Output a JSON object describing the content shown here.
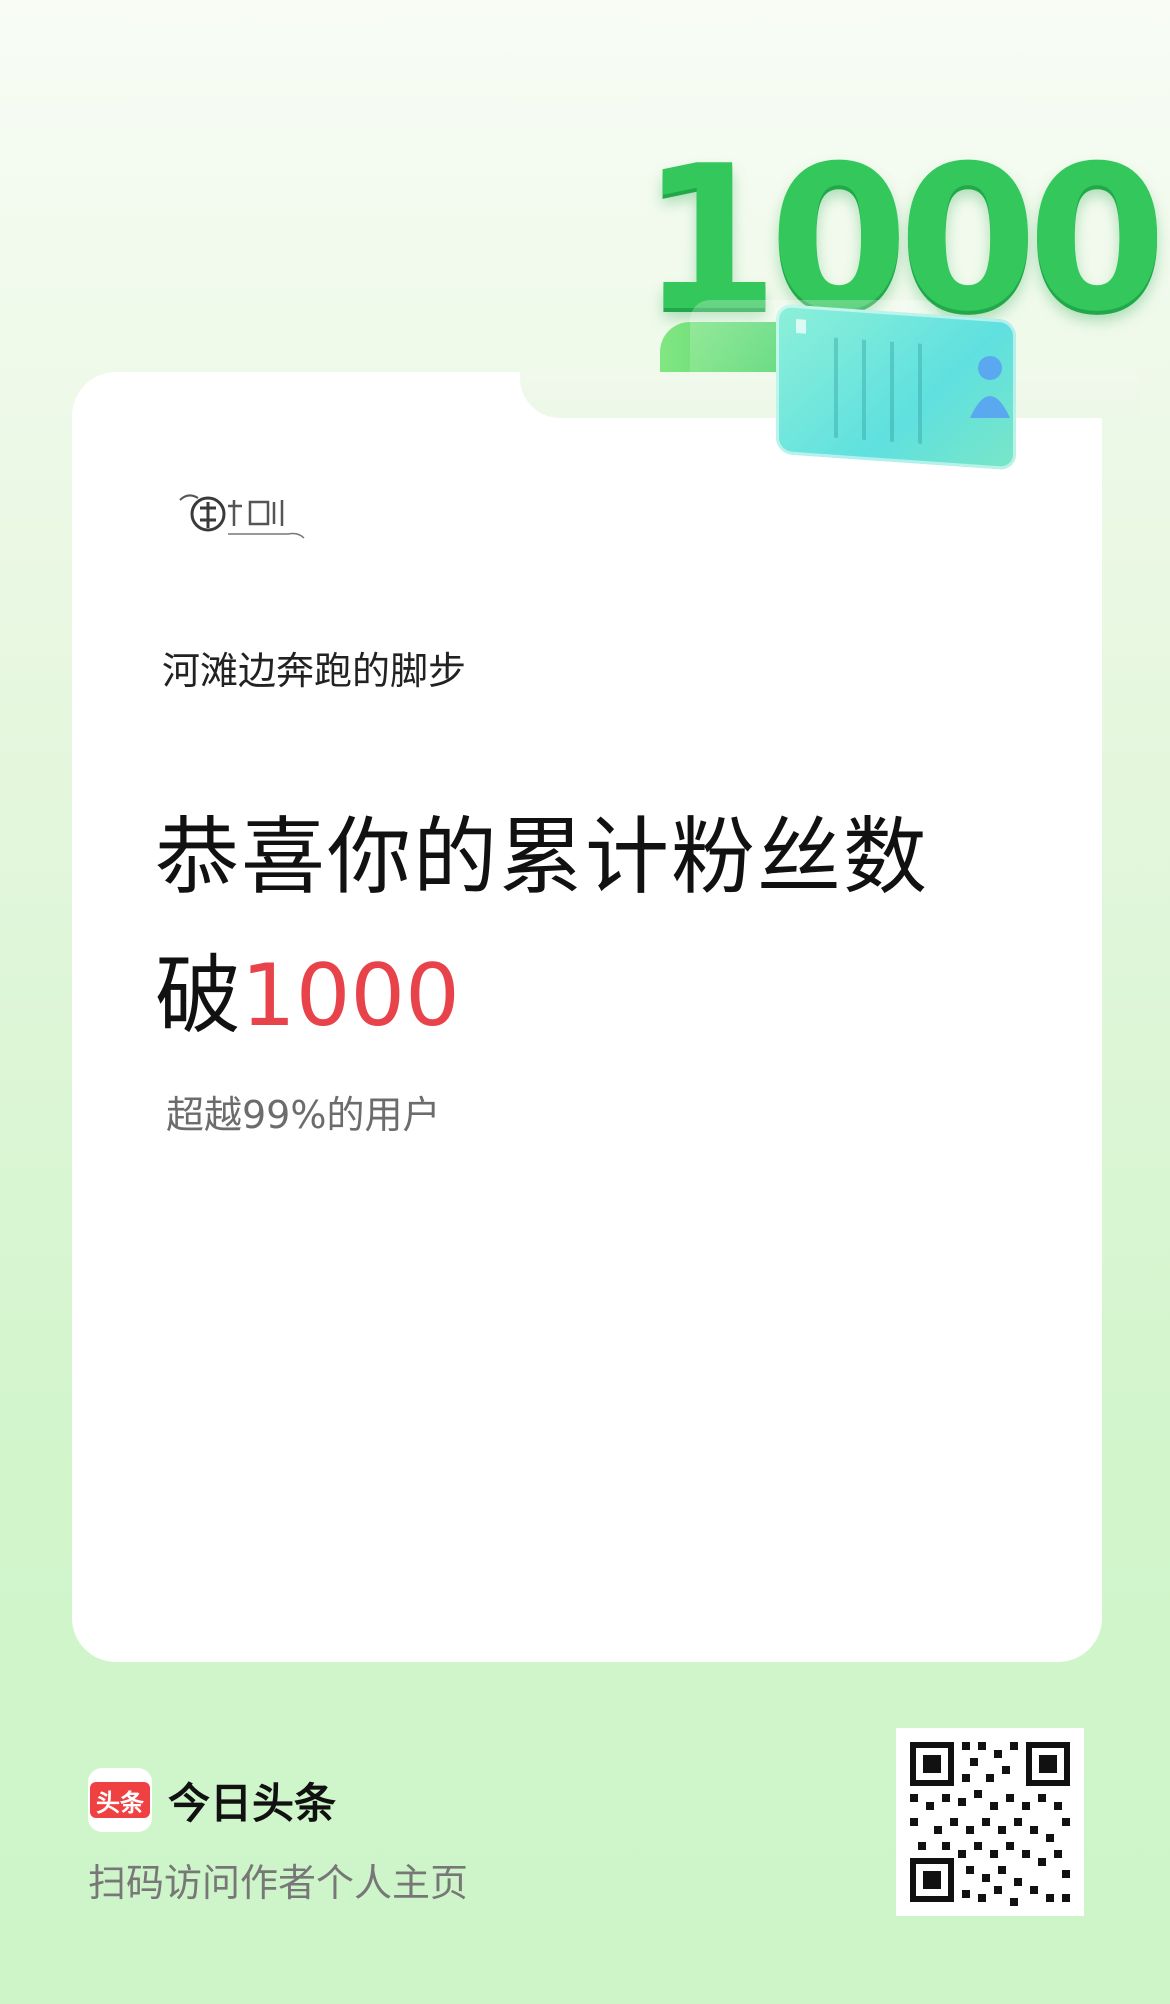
{
  "badge": {
    "number": "1000"
  },
  "logo": {
    "alt_text": "南坊剧场"
  },
  "card": {
    "account_name": "河滩边奔跑的脚步",
    "headline_line1": "恭喜你的累计粉丝数",
    "headline_prefix": "破",
    "headline_number": "1000",
    "rank_text": "超越99%的用户"
  },
  "footer": {
    "brand_badge": "头条",
    "brand_name": "今日头条",
    "scan_text": "扫码访问作者个人主页"
  },
  "colors": {
    "accent_red": "#e8434b",
    "badge_green": "#34c75c",
    "brand_red": "#f04142"
  }
}
